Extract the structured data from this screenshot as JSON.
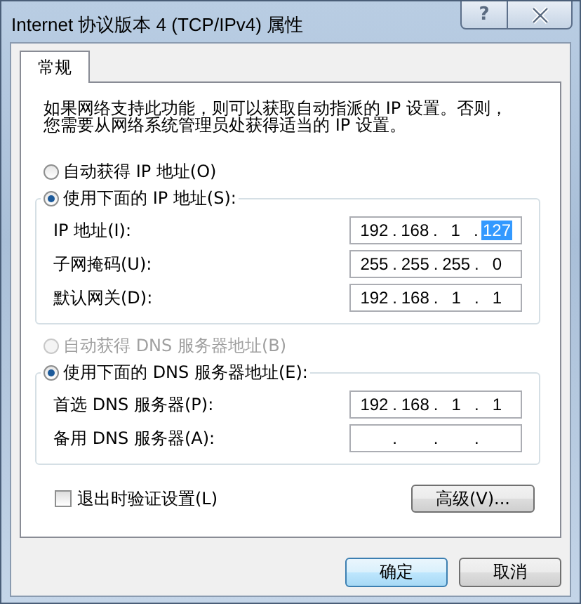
{
  "window": {
    "title": "Internet 协议版本 4 (TCP/IPv4) 属性",
    "help_glyph": "?"
  },
  "tabs": [
    {
      "label": "常规",
      "selected": true
    }
  ],
  "intro": [
    "如果网络支持此功能，则可以获取自动指派的 IP 设置。否则，",
    "您需要从网络系统管理员处获得适当的 IP 设置。"
  ],
  "ip_section": {
    "auto_radio": {
      "label": "自动获得 IP 地址(O)",
      "selected": false,
      "disabled": false
    },
    "manual_radio": {
      "label": "使用下面的 IP 地址(S):",
      "selected": true,
      "disabled": false
    },
    "fields": [
      {
        "label": "IP 地址(I):",
        "separator": ".",
        "octets": [
          {
            "text": "192",
            "selected": false
          },
          {
            "text": "168",
            "selected": false
          },
          {
            "text": "1",
            "selected": false
          },
          {
            "text": "127",
            "selected": true
          }
        ]
      },
      {
        "label": "子网掩码(U):",
        "separator": ".",
        "octets": [
          {
            "text": "255",
            "selected": false
          },
          {
            "text": "255",
            "selected": false
          },
          {
            "text": "255",
            "selected": false
          },
          {
            "text": "0",
            "selected": false
          }
        ]
      },
      {
        "label": "默认网关(D):",
        "separator": ".",
        "octets": [
          {
            "text": "192",
            "selected": false
          },
          {
            "text": "168",
            "selected": false
          },
          {
            "text": "1",
            "selected": false
          },
          {
            "text": "1",
            "selected": false
          }
        ]
      }
    ]
  },
  "dns_section": {
    "auto_radio": {
      "label": "自动获得 DNS 服务器地址(B)",
      "selected": false,
      "disabled": true
    },
    "manual_radio": {
      "label": "使用下面的 DNS 服务器地址(E):",
      "selected": true,
      "disabled": false
    },
    "fields": [
      {
        "label": "首选 DNS 服务器(P):",
        "separator": ".",
        "octets": [
          {
            "text": "192",
            "selected": false
          },
          {
            "text": "168",
            "selected": false
          },
          {
            "text": "1",
            "selected": false
          },
          {
            "text": "1",
            "selected": false
          }
        ]
      },
      {
        "label": "备用 DNS 服务器(A):",
        "separator": "."
      }
    ]
  },
  "validate_checkbox": {
    "label": "退出时验证设置(L)",
    "checked": false
  },
  "advanced_button": "高级(V)...",
  "buttons": [
    "确定",
    "取消"
  ]
}
